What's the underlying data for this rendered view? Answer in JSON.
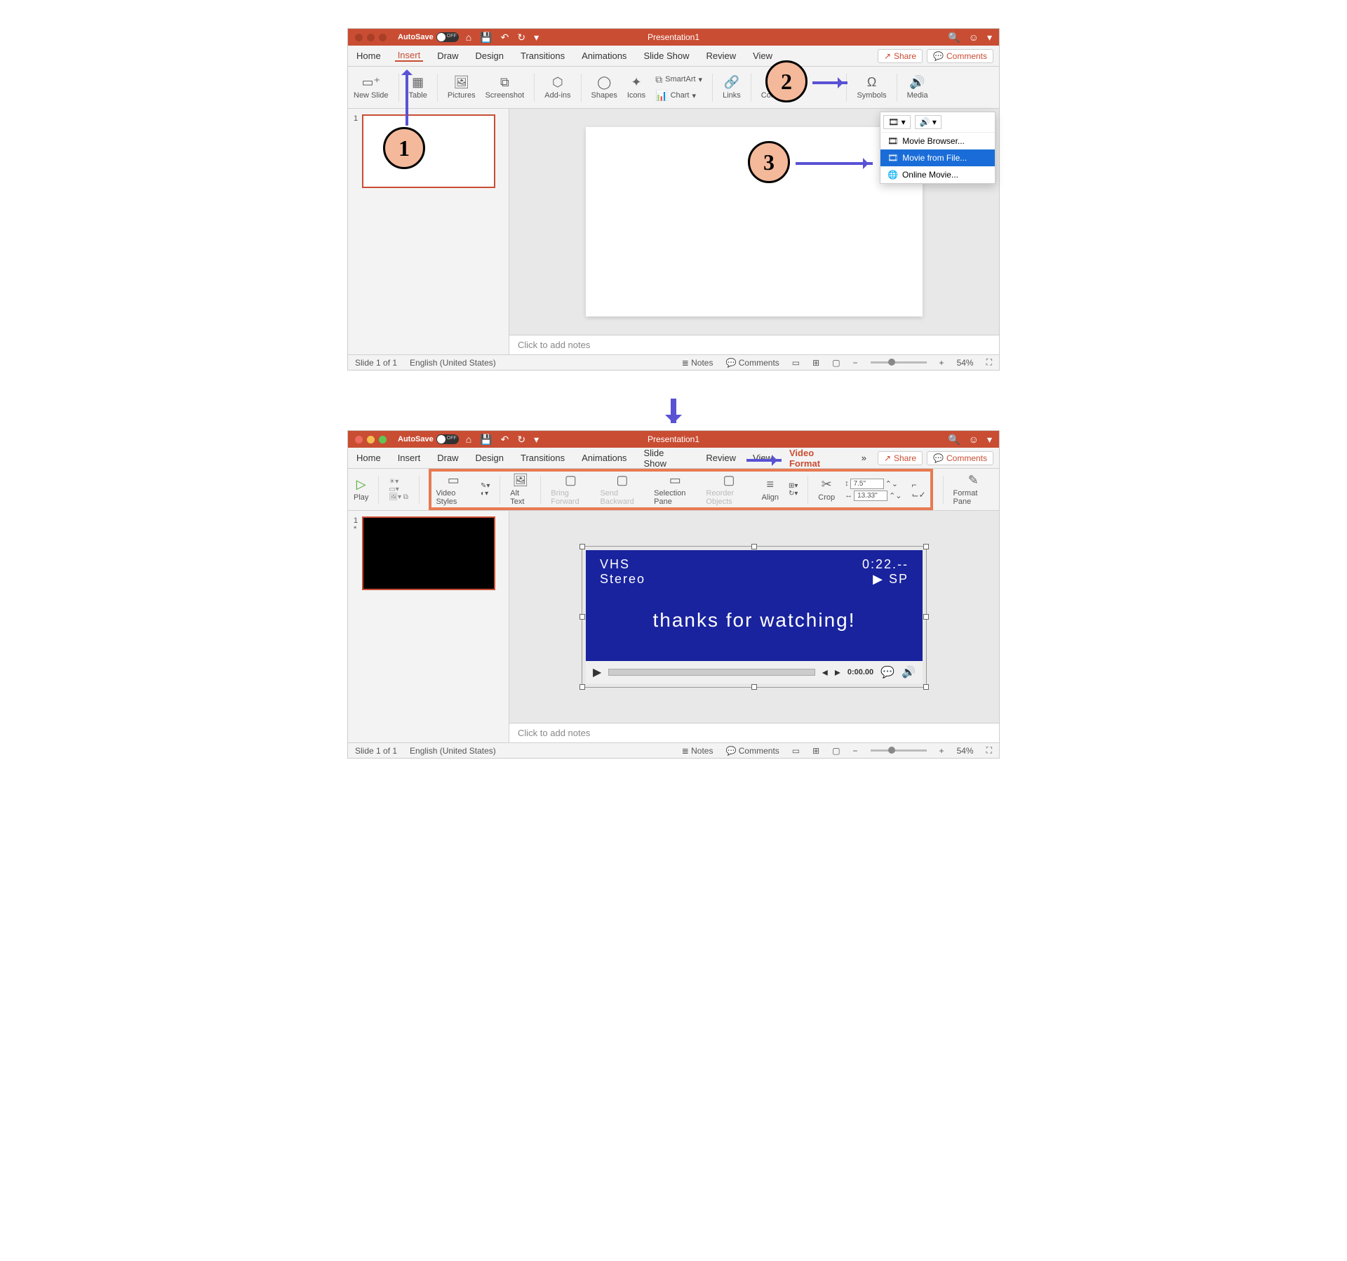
{
  "annotations": {
    "step1": "1",
    "step2": "2",
    "step3": "3"
  },
  "titlebar": {
    "autosave": "AutoSave",
    "doctitle": "Presentation1",
    "icons": {
      "home": "⌂",
      "save": "💾",
      "undo": "↶",
      "redo": "↻",
      "more": "▾",
      "search": "🔍",
      "smile": "☺"
    }
  },
  "tabs": [
    "Home",
    "Insert",
    "Draw",
    "Design",
    "Transitions",
    "Animations",
    "Slide Show",
    "Review",
    "View"
  ],
  "video_format_tab": "Video Format",
  "share": "Share",
  "comments": "Comments",
  "ribbon1": {
    "newslide": "New Slide",
    "table": "Table",
    "pictures": "Pictures",
    "screenshot": "Screenshot",
    "addins": "Add-ins",
    "shapes": "Shapes",
    "icons": "Icons",
    "smartart": "SmartArt",
    "chart": "Chart",
    "links": "Links",
    "comment": "Comment",
    "symbols": "Symbols",
    "media": "Media"
  },
  "dropdown": {
    "movie_browser": "Movie Browser...",
    "movie_from_file": "Movie from File...",
    "online_movie": "Online Movie..."
  },
  "notes_placeholder": "Click to add notes",
  "statusbar": {
    "slide": "Slide 1 of 1",
    "lang": "English (United States)",
    "notes": "Notes",
    "comments": "Comments",
    "zoom": "54%"
  },
  "ribbon2": {
    "play": "Play",
    "video_styles": "Video Styles",
    "alt_text": "Alt Text",
    "bring_forward": "Bring Forward",
    "send_backward": "Send Backward",
    "selection_pane": "Selection Pane",
    "reorder": "Reorder Objects",
    "align": "Align",
    "crop": "Crop",
    "format_pane": "Format Pane",
    "height": "7.5\"",
    "width": "13.33\""
  },
  "video": {
    "vhs": "VHS",
    "stereo": "Stereo",
    "time": "0:22.--",
    "sp": "▶  SP",
    "message": "thanks for watching!",
    "playtime": "0:00.00"
  },
  "thumb_num": "1",
  "asterisk": "*"
}
